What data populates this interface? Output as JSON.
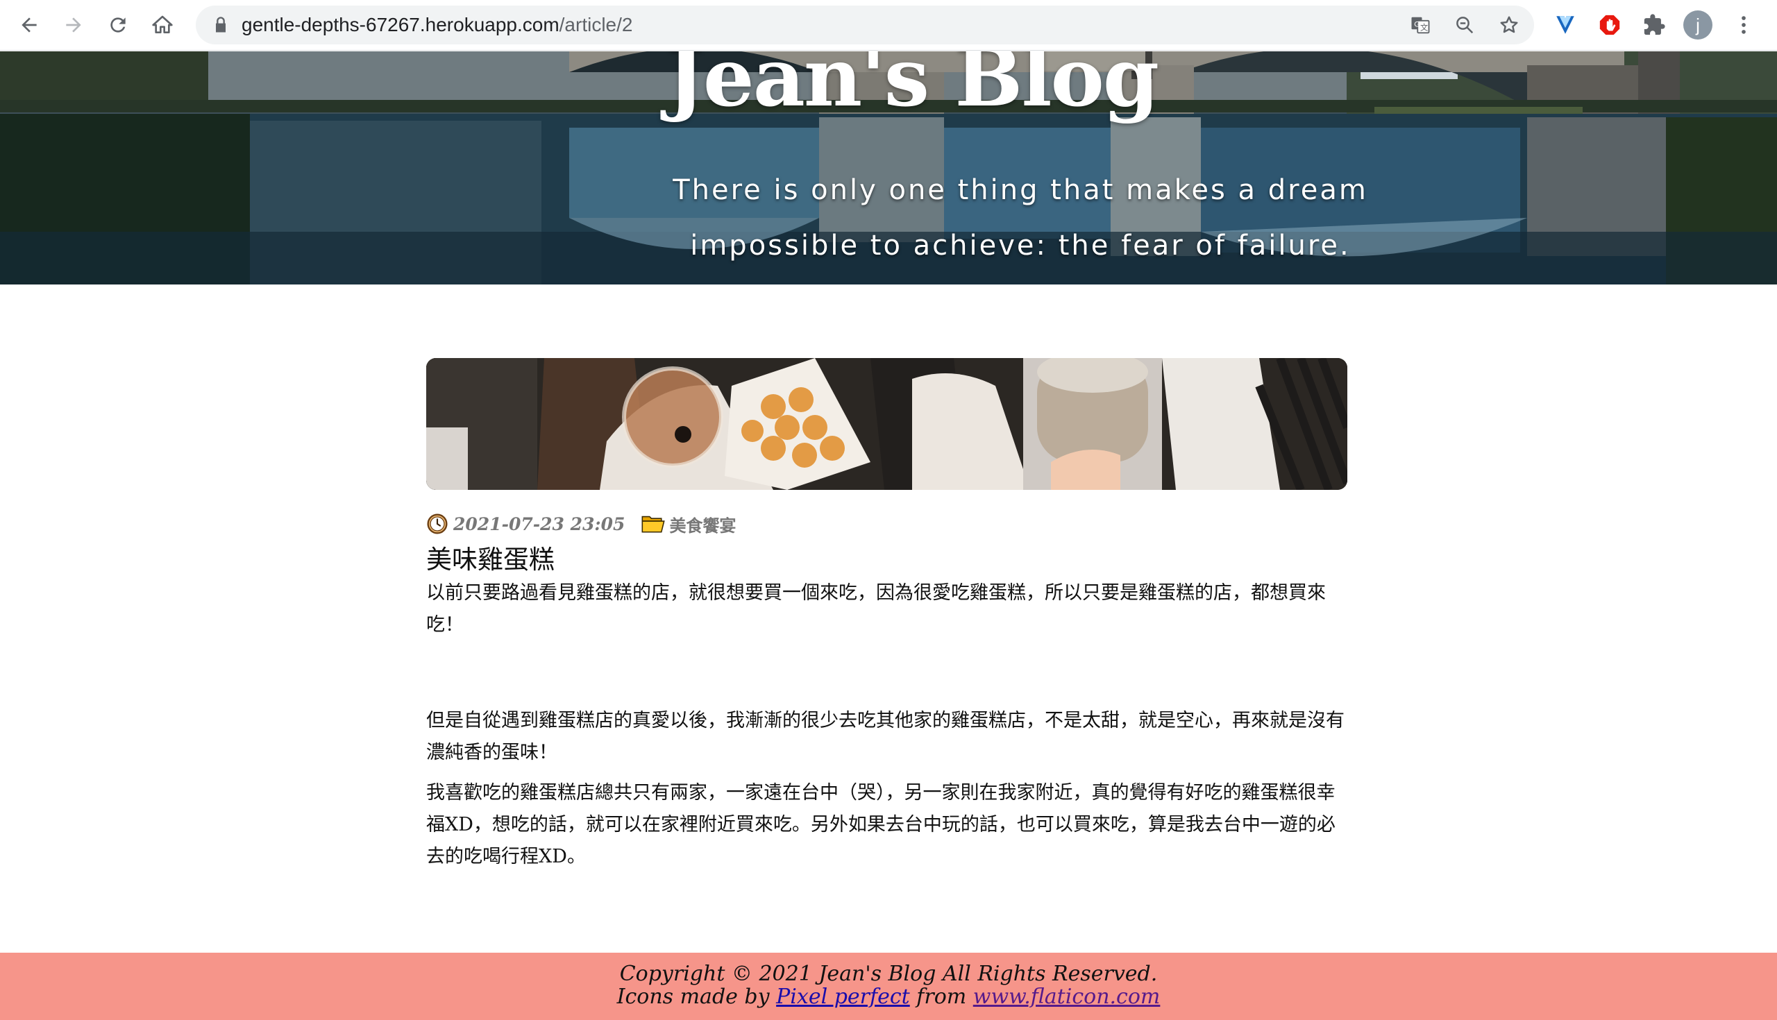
{
  "browser": {
    "url_host": "gentle-depths-67267.herokuapp.com",
    "url_path": "/article/2",
    "profile_initial": "j"
  },
  "hero": {
    "title": "Jean's Blog",
    "quote_line1": "There is only one thing that makes a dream",
    "quote_line2": "impossible to achieve: the fear of failure."
  },
  "post": {
    "datetime": "2021-07-23 23:05",
    "category": "美食饗宴",
    "title": "美味雞蛋糕",
    "paragraphs": [
      "以前只要路過看見雞蛋糕的店，就很想要買一個來吃，因為很愛吃雞蛋糕，所以只要是雞蛋糕的店，都想買來吃！",
      "但是自從遇到雞蛋糕店的真愛以後，我漸漸的很少去吃其他家的雞蛋糕店，不是太甜，就是空心，再來就是沒有濃純香的蛋味！",
      "我喜歡吃的雞蛋糕店總共只有兩家，一家遠在台中（哭），另一家則在我家附近，真的覺得有好吃的雞蛋糕很幸福XD，想吃的話，就可以在家裡附近買來吃。另外如果去台中玩的話，也可以買來吃，算是我去台中一遊的必去的吃喝行程XD。"
    ]
  },
  "footer": {
    "copyright": "Copyright © 2021 Jean's Blog All Rights Reserved.",
    "icons_prefix": "Icons made by ",
    "icons_author": "Pixel perfect",
    "icons_middle": " from ",
    "icons_site": "www.flaticon.com"
  }
}
